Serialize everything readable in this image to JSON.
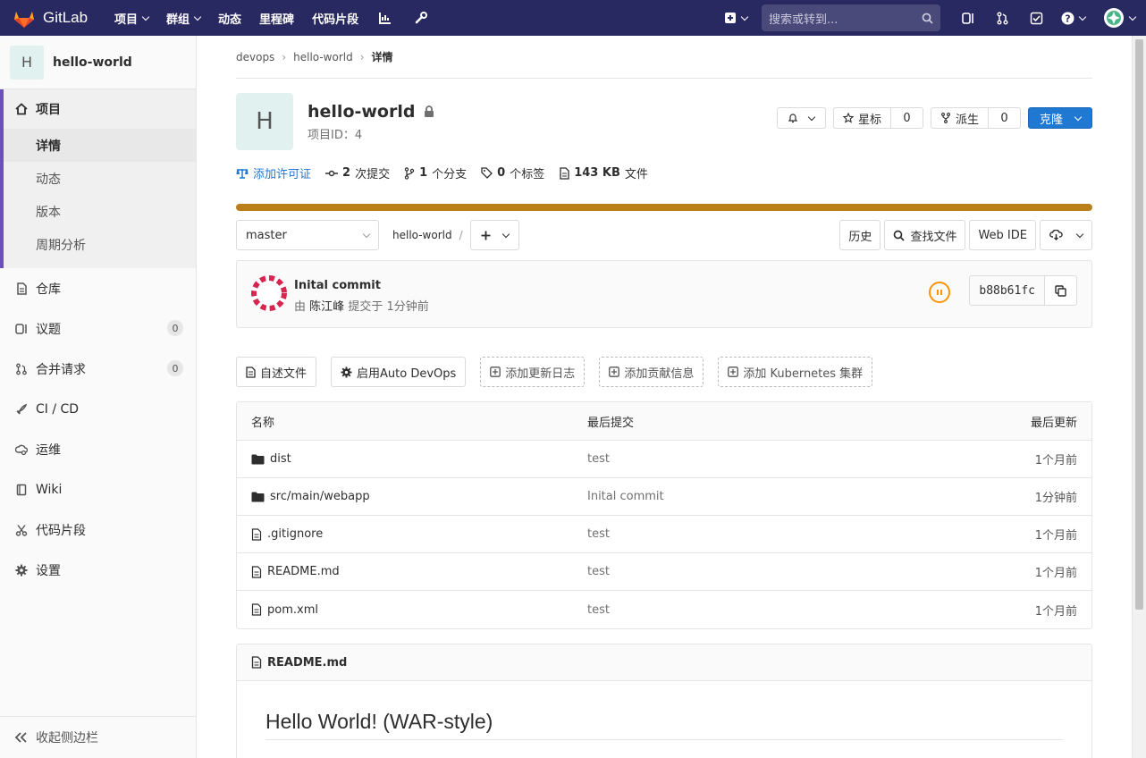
{
  "topnav": {
    "brand": "GitLab",
    "links": [
      "项目",
      "群组",
      "动态",
      "里程碑",
      "代码片段"
    ],
    "search_placeholder": "搜索或转到..."
  },
  "sidebar": {
    "project_initial": "H",
    "project_name": "hello-world",
    "project_label": "项目",
    "sub_items": [
      "详情",
      "动态",
      "版本",
      "周期分析"
    ],
    "items": [
      {
        "label": "仓库"
      },
      {
        "label": "议题",
        "badge": "0"
      },
      {
        "label": "合并请求",
        "badge": "0"
      },
      {
        "label": "CI / CD"
      },
      {
        "label": "运维"
      },
      {
        "label": "Wiki"
      },
      {
        "label": "代码片段"
      },
      {
        "label": "设置"
      }
    ],
    "collapse": "收起侧边栏"
  },
  "breadcrumb": [
    "devops",
    "hello-world",
    "详情"
  ],
  "project": {
    "initial": "H",
    "name": "hello-world",
    "id_text": "项目ID：4",
    "star_label": "星标",
    "star_count": "0",
    "fork_label": "派生",
    "fork_count": "0",
    "clone_label": "克隆"
  },
  "stats": {
    "license": "添加许可证",
    "commits_num": "2",
    "commits_label": "次提交",
    "branches_num": "1",
    "branches_label": "个分支",
    "tags_num": "0",
    "tags_label": "个标签",
    "size_num": "143 KB",
    "size_label": "文件"
  },
  "toolbar": {
    "branch": "master",
    "path": "hello-world",
    "path_sep": "/",
    "history": "历史",
    "find_file": "查找文件",
    "web_ide": "Web IDE"
  },
  "commit": {
    "title": "Inital commit",
    "by": "由",
    "author": "陈江峰",
    "when": "提交于 1分钟前",
    "sha": "b88b61fc"
  },
  "shortcuts": {
    "readme": "自述文件",
    "autodevops": "启用Auto DevOps",
    "changelog": "添加更新日志",
    "contributing": "添加贡献信息",
    "k8s": "添加 Kubernetes 集群"
  },
  "table": {
    "headers": [
      "名称",
      "最后提交",
      "最后更新"
    ],
    "rows": [
      {
        "name": "dist",
        "commit": "test",
        "updated": "1个月前",
        "type": "folder"
      },
      {
        "name": "src/main/webapp",
        "commit": "Inital commit",
        "updated": "1分钟前",
        "type": "folder"
      },
      {
        "name": ".gitignore",
        "commit": "test",
        "updated": "1个月前",
        "type": "file"
      },
      {
        "name": "README.md",
        "commit": "test",
        "updated": "1个月前",
        "type": "file"
      },
      {
        "name": "pom.xml",
        "commit": "test",
        "updated": "1个月前",
        "type": "file"
      }
    ]
  },
  "readme": {
    "filename": "README.md",
    "heading": "Hello World! (WAR-style)"
  },
  "colors": {
    "nav_bg": "#292961",
    "accent": "#6b4fbb",
    "clone_blue": "#1f78d1",
    "progress": "#b98018",
    "pipeline": "#fc9403"
  }
}
